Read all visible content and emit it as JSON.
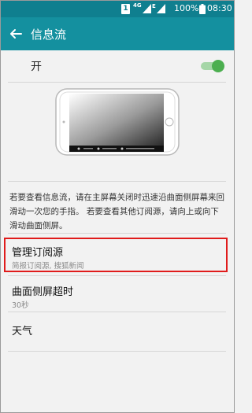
{
  "status_bar": {
    "sim_label": "1",
    "net_4g": "4G",
    "net_e": "E",
    "battery": "100%",
    "time": "08:30"
  },
  "header": {
    "title": "信息流",
    "back_icon": "arrow-left-icon"
  },
  "toggle": {
    "label": "开",
    "state": "on",
    "color": "#4caf50"
  },
  "description": "若要查看信息流，请在主屏幕关闭时迅速沿曲面侧屏幕来回滑动一次您的手指。 若要查看其他订阅源，请向上或向下滑动曲面侧屏。",
  "settings": [
    {
      "title": "管理订阅源",
      "summary": "简报订阅源, 搜狐新闻"
    },
    {
      "title": "曲面侧屏超时",
      "summary": "30秒"
    },
    {
      "title": "天气",
      "summary": ""
    }
  ],
  "colors": {
    "status_bar": "#0f7f8f",
    "action_bar": "#14909f",
    "highlight": "#e01b1b"
  }
}
